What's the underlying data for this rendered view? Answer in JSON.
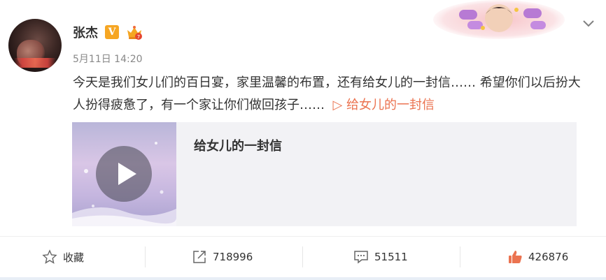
{
  "post": {
    "author": "张杰",
    "date": "5月11日 14:20",
    "text_main": "今天是我们女儿们的百日宴，家里温馨的布置，还有给女儿的一封信…… 希望你们以后扮大人扮得疲惫了，有一个家让你们做回孩子……",
    "link_text": "▷ 给女儿的一封信"
  },
  "media": {
    "title": "给女儿的一封信"
  },
  "actions": {
    "favorite_label": "收藏",
    "share_count": "718996",
    "comment_count": "51511",
    "like_count": "426876"
  },
  "colors": {
    "accent": "#eb7350",
    "vip": "#f6a623"
  }
}
